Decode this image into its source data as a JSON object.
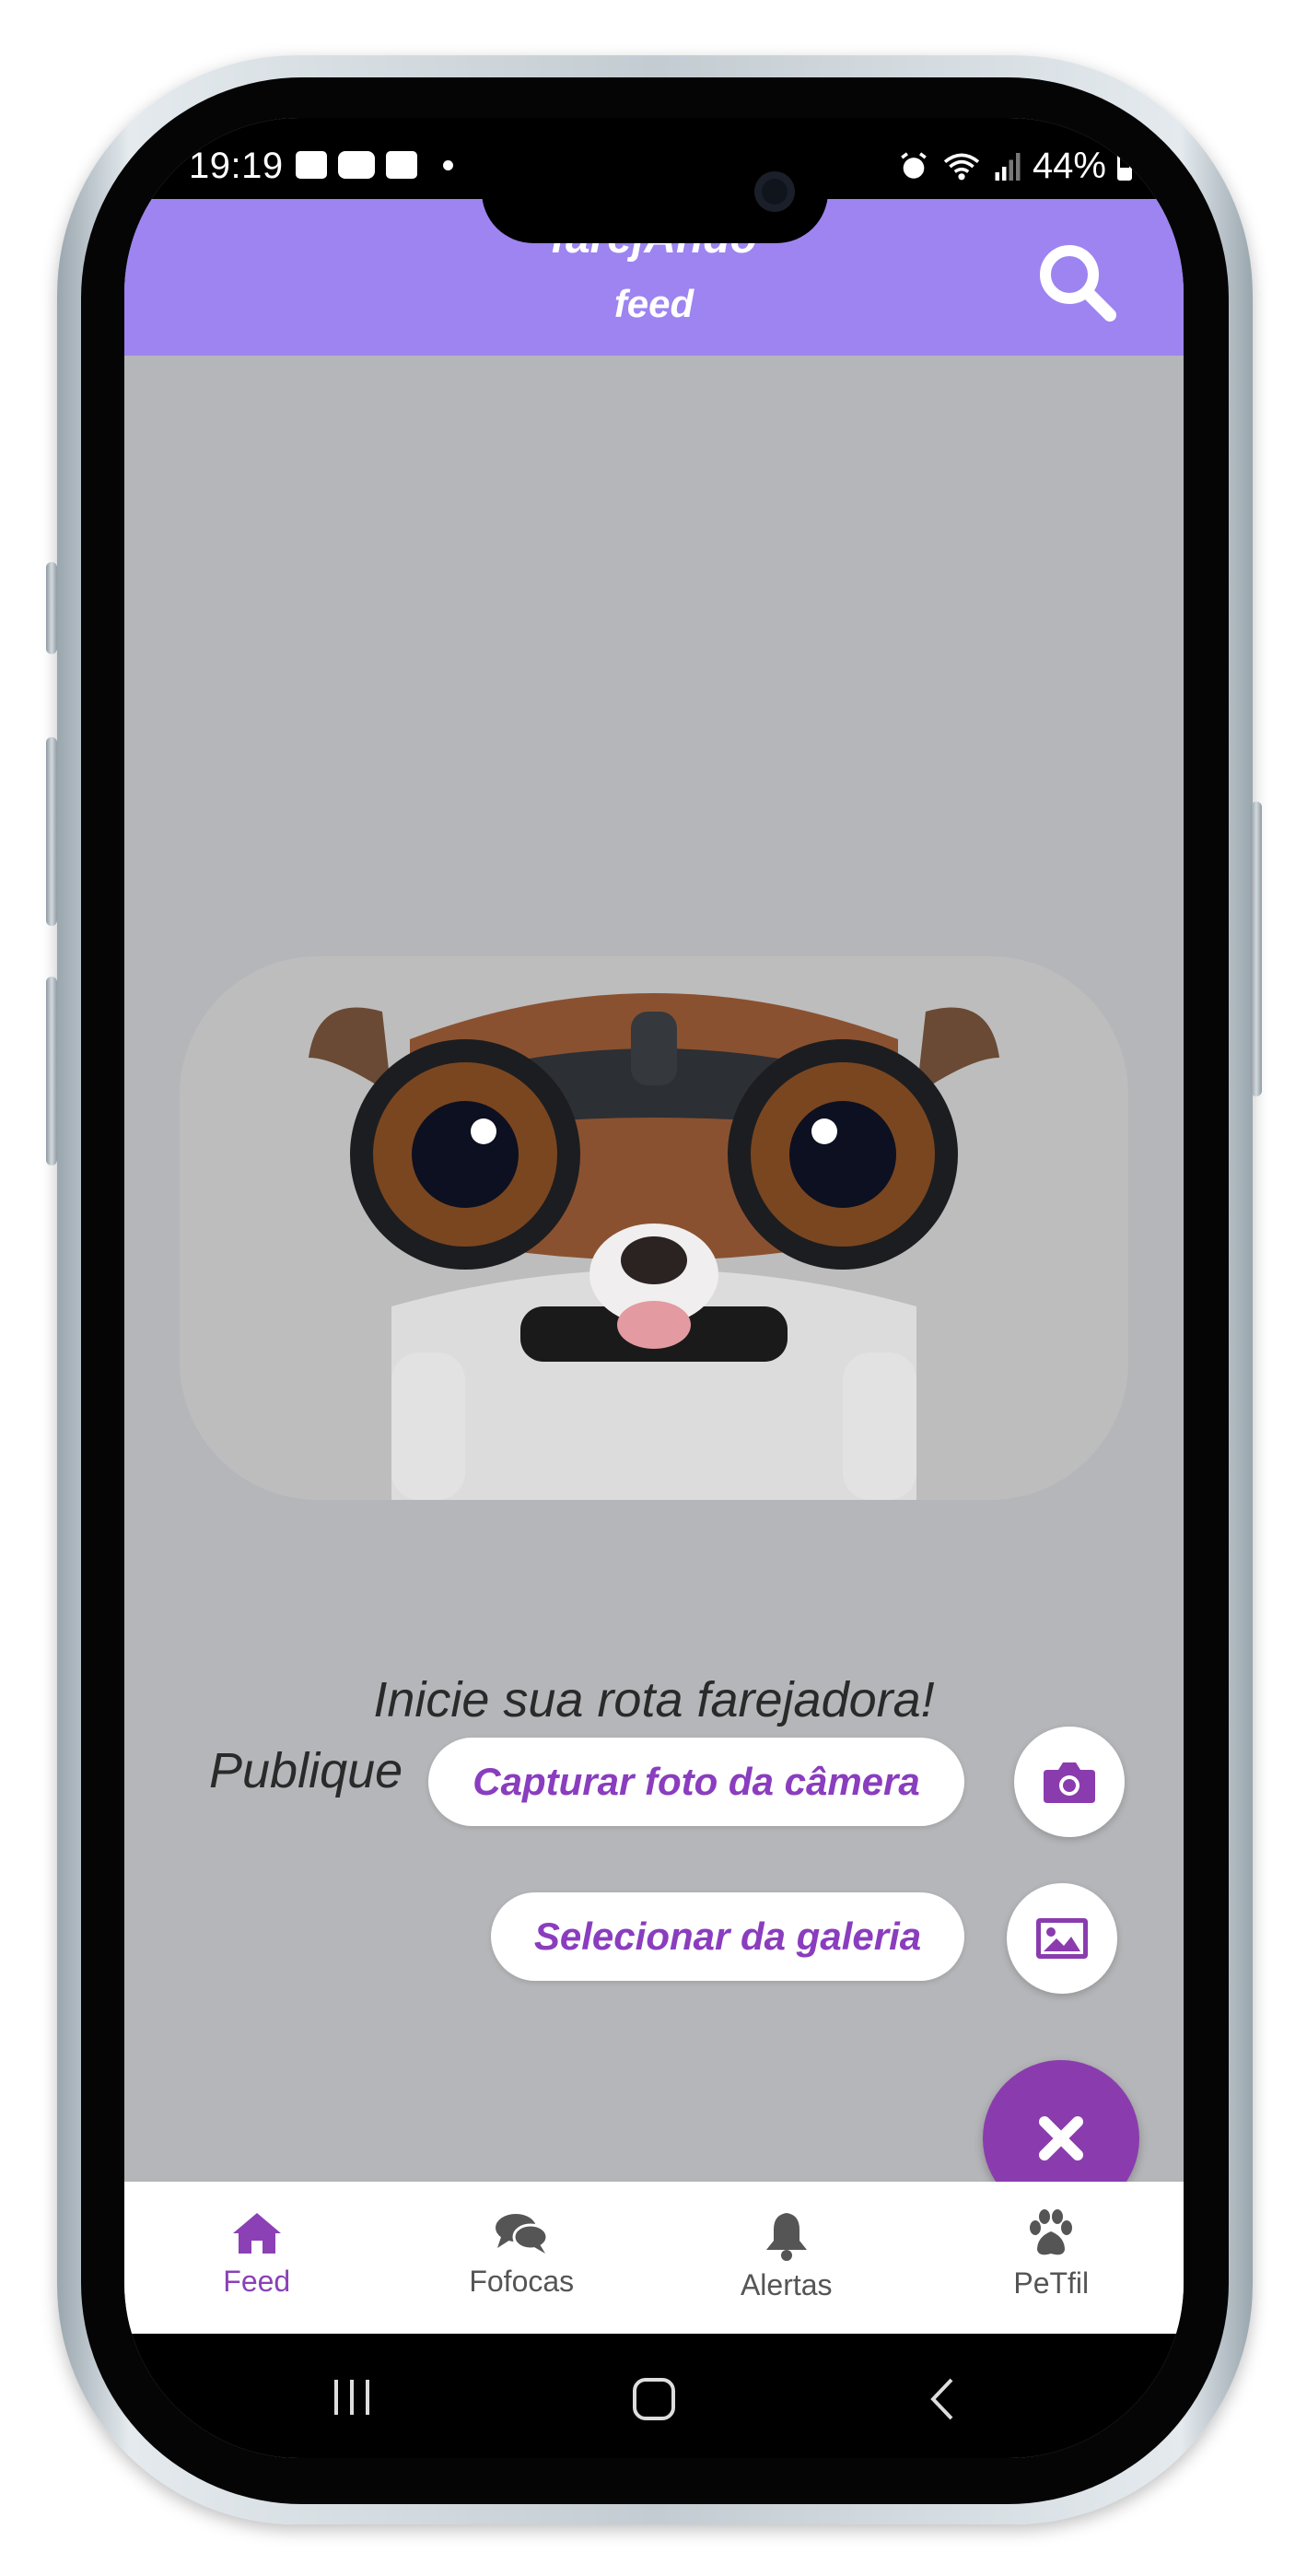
{
  "status_bar": {
    "time": "19:19",
    "battery": "44%",
    "left_icons": [
      "image-icon",
      "youtube-icon",
      "checkbox-icon",
      "dot-icon"
    ],
    "right_icons": [
      "alarm-icon",
      "wifi-icon",
      "signal-icon",
      "battery-icon"
    ]
  },
  "header": {
    "title": "farejAndo",
    "subtitle": "feed",
    "search_icon": "search-icon",
    "color": "#9d84f0"
  },
  "empty_state": {
    "line1": "Inicie sua rota farejadora!",
    "line2": "Publique",
    "image_alt": "dog-with-binoculars-illustration"
  },
  "actions": {
    "camera_label": "Capturar foto da câmera",
    "camera_icon": "camera-icon",
    "gallery_label": "Selecionar da galeria",
    "gallery_icon": "image-icon",
    "close_icon": "close-icon",
    "accent": "#8a3cae"
  },
  "bottom_nav": {
    "items": [
      {
        "label": "Feed",
        "icon": "home-icon",
        "active": true
      },
      {
        "label": "Fofocas",
        "icon": "chat-icon",
        "active": false
      },
      {
        "label": "Alertas",
        "icon": "bell-icon",
        "active": false
      },
      {
        "label": "PeTfil",
        "icon": "paw-icon",
        "active": false
      }
    ]
  },
  "system_nav": [
    "recents-button",
    "home-button",
    "back-button"
  ]
}
